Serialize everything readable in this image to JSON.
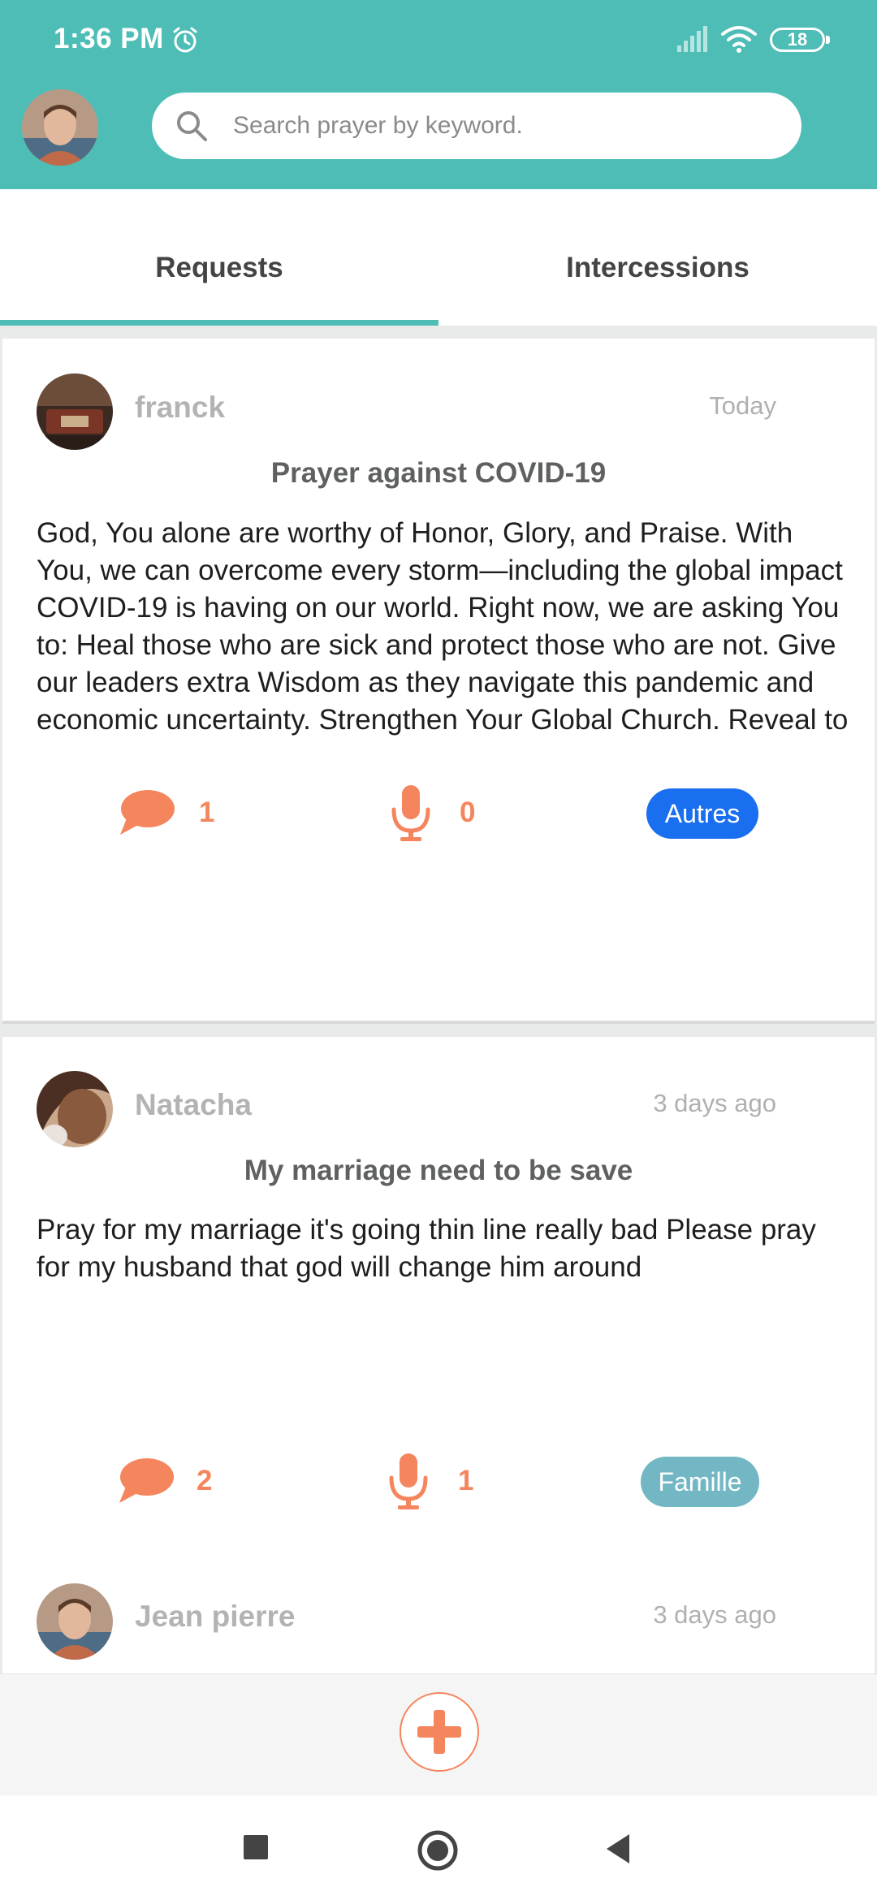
{
  "status_bar": {
    "time": "1:36 PM",
    "battery": "18"
  },
  "search": {
    "placeholder": "Search prayer by keyword."
  },
  "tabs": [
    {
      "label": "Requests"
    },
    {
      "label": "Intercessions"
    }
  ],
  "posts": [
    {
      "user": "franck",
      "date": "Today",
      "title": "Prayer against COVID-19",
      "body": "God, You alone are worthy of Honor, Glory, and Praise. With You, we can overcome every storm—including the global impact COVID-19 is having on our world. Right now, we are asking You to:  Heal those who are sick and protect those who are not.  Give our leaders extra Wisdom as they navigate this pandemic and economic uncertainty.  Strengthen Your Global Church. Reveal to …",
      "comments": "1",
      "intercessions": "0",
      "tag": "Autres",
      "tag_color": "#1a6ef0"
    },
    {
      "user": "Natacha",
      "date": "3 days ago",
      "title": "My marriage need to be save",
      "body": "Pray for my marriage it's going thin line really bad Please pray for my husband that god will change him around",
      "comments": "2",
      "intercessions": "1",
      "tag": "Famille",
      "tag_color": "#72b7c3"
    },
    {
      "user": "Jean pierre",
      "date": "3 days ago"
    }
  ],
  "colors": {
    "accent": "#4dbdb6",
    "action": "#f4855d"
  },
  "icons": {
    "comment": "chat-bubble-icon",
    "intercession": "microphone-icon",
    "add": "plus-icon"
  }
}
